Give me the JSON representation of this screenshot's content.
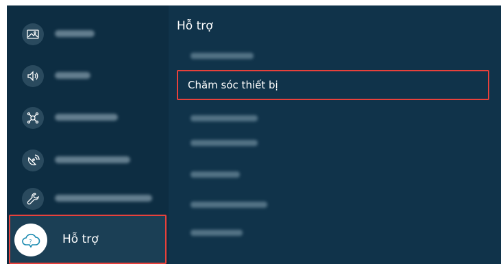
{
  "sidebar": {
    "items": [
      {
        "icon": "picture-icon"
      },
      {
        "icon": "sound-icon"
      },
      {
        "icon": "connection-icon"
      },
      {
        "icon": "broadcasting-icon"
      },
      {
        "icon": "wrench-icon"
      }
    ],
    "active": {
      "icon": "cloud-question-icon",
      "label": "Hỗ trợ"
    }
  },
  "panel": {
    "title": "Hỗ trợ",
    "focused_item": "Chăm sóc thiết bị"
  },
  "colors": {
    "background": "#10334a",
    "sidebar": "#0d2d42",
    "focus_border": "#e8413b",
    "text": "#ffffff"
  }
}
